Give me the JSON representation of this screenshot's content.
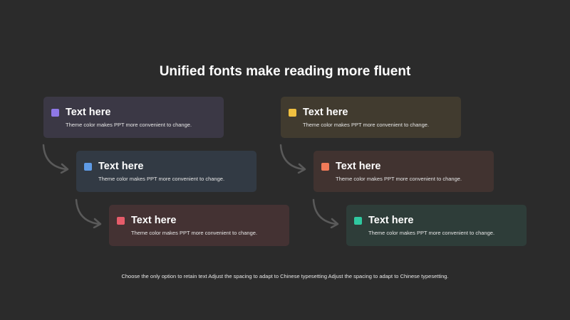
{
  "title": "Unified fonts make reading more fluent",
  "cards": [
    {
      "heading": "Text here",
      "description": "Theme color makes PPT more convenient to change.",
      "accent": "#8e78e6",
      "background": "#3b3845"
    },
    {
      "heading": "Text here",
      "description": "Theme color makes PPT more convenient to change.",
      "accent": "#5e9be6",
      "background": "#323a44"
    },
    {
      "heading": "Text here",
      "description": "Theme color makes PPT more convenient to change.",
      "accent": "#e65c6a",
      "background": "#443233"
    },
    {
      "heading": "Text here",
      "description": "Theme color makes PPT more convenient to change.",
      "accent": "#f0c040",
      "background": "#413b2f"
    },
    {
      "heading": "Text here",
      "description": "Theme color makes PPT more convenient to change.",
      "accent": "#f07a58",
      "background": "#413330"
    },
    {
      "heading": "Text here",
      "description": "Theme color makes PPT more convenient to change.",
      "accent": "#2fc8a0",
      "background": "#2e3d39"
    }
  ],
  "footer": "Choose the only option to retain text Adjust the spacing to adapt to Chinese typesetting Adjust the spacing to adapt to Chinese typesetting.",
  "colors": {
    "page_background": "#2b2b2b",
    "arrow": "#5a5a5a"
  },
  "icons": {
    "connector": "curved-arrow-icon"
  }
}
